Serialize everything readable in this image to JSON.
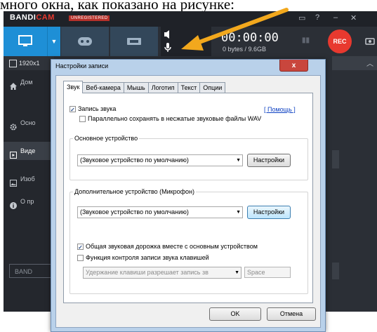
{
  "caption": "много окна, как показано на рисунке:",
  "app": {
    "brand_main": "BANDI",
    "brand_accent": "CAM",
    "unregistered": "UNREGISTERED",
    "question": "?",
    "timer": "00:00:00",
    "size": "0 bytes / 9.6GB",
    "rec_label": "REC",
    "resolution": "1920x1",
    "nav": [
      "Дом",
      "Осно",
      "Виде",
      "Изоб",
      "О пр"
    ],
    "bandi_button": "BAND"
  },
  "dialog": {
    "title": "Настройки записи",
    "close": "x",
    "tabs": [
      "Звук",
      "Веб-камера",
      "Мышь",
      "Логотип",
      "Текст",
      "Опции"
    ],
    "record_sound": "Запись звука",
    "parallel_wav": "Параллельно сохранять в несжатые звуковые файлы WAV",
    "help_link": "[ Помощь ]",
    "primary_group": "Основное устройство",
    "primary_device": "(Звуковое устройство по умолчанию)",
    "secondary_group": "Дополнительное устройство (Микрофон)",
    "secondary_device": "(Звуковое устройство по умолчанию)",
    "settings_label": "Настройки",
    "mix_track": "Общая звуковая дорожка вместе с основным устройством",
    "hotkey_control": "Функция контроля записи звука клавишей",
    "hotkey_mode": "Удержание клавиши разрешает запись зв",
    "hotkey_key": "Space",
    "ok_label": "OK",
    "cancel_label": "Отмена"
  },
  "colors": {
    "accent_blue": "#1e8fd6",
    "rec_red": "#e8392f",
    "arrow_orange": "#f2a81d",
    "app_dark": "#2b2f36"
  }
}
